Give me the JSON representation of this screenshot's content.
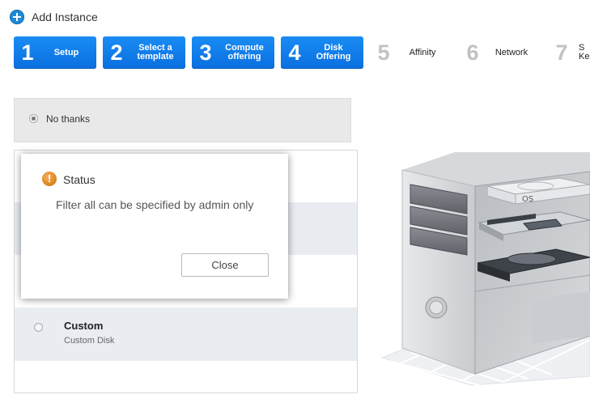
{
  "header": {
    "title": "Add Instance",
    "icon": "plus-circle-icon",
    "accent": "#1f8ad6"
  },
  "steps": [
    {
      "num": "1",
      "label": "Setup",
      "active": true
    },
    {
      "num": "2",
      "label": "Select a template",
      "active": true
    },
    {
      "num": "3",
      "label": "Compute offering",
      "active": true
    },
    {
      "num": "4",
      "label": "Disk Offering",
      "active": true
    },
    {
      "num": "5",
      "label": "Affinity",
      "active": false
    },
    {
      "num": "6",
      "label": "Network",
      "active": false
    },
    {
      "num": "7",
      "label": "S Ke",
      "active": false
    }
  ],
  "disk_offering": {
    "no_thanks": {
      "label": "No thanks",
      "selected": true
    },
    "options": [
      {
        "name": "Custom",
        "description": "Custom Disk",
        "selected": false
      }
    ]
  },
  "dialog": {
    "title": "Status",
    "message": "Filter all can be specified by admin only",
    "close_label": "Close",
    "icon": "warning-icon"
  },
  "illustration": {
    "label": "OS"
  }
}
